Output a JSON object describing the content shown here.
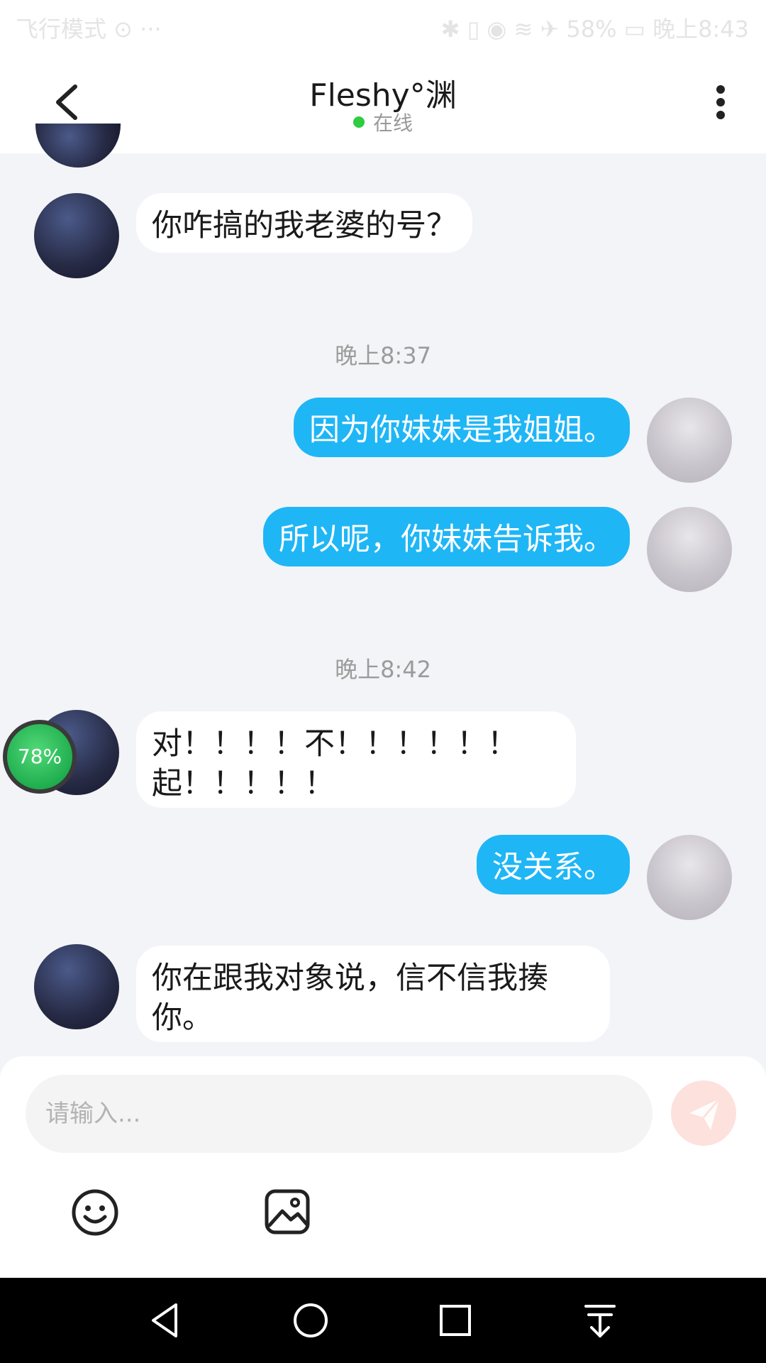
{
  "status_bar": {
    "left": "飞行模式 ⊙ ··· ",
    "right": "✱ ▯ ◉ ≋ ✈ 58% ▭ 晚上8:43"
  },
  "header": {
    "title": "Fleshy°渊",
    "status": "在线"
  },
  "messages": [
    {
      "side": "in",
      "text": "你咋搞的我老婆的号？"
    },
    {
      "type": "time",
      "text": "晚上8:37"
    },
    {
      "side": "out",
      "text": "因为你妹妹是我姐姐。"
    },
    {
      "side": "out",
      "text": "所以呢，你妹妹告诉我。"
    },
    {
      "type": "time",
      "text": "晚上8:42"
    },
    {
      "side": "in",
      "text": "对！！！！不！！！！！！\n起！！！！！"
    },
    {
      "side": "out",
      "text": "没关系。"
    },
    {
      "side": "in",
      "text": "你在跟我对象说，信不信我揍\n你。"
    }
  ],
  "overlay_badge": "78%",
  "composer": {
    "placeholder": "请输入..."
  },
  "icons": {
    "back": "chevron-left-icon",
    "more": "more-vertical-icon",
    "send": "send-icon",
    "emoji": "emoji-icon",
    "image": "image-icon"
  },
  "colors": {
    "outgoing_bubble": "#1fb6f6",
    "incoming_bubble": "#ffffff",
    "online_dot": "#2ecc40",
    "send_button": "#fde1dd"
  }
}
